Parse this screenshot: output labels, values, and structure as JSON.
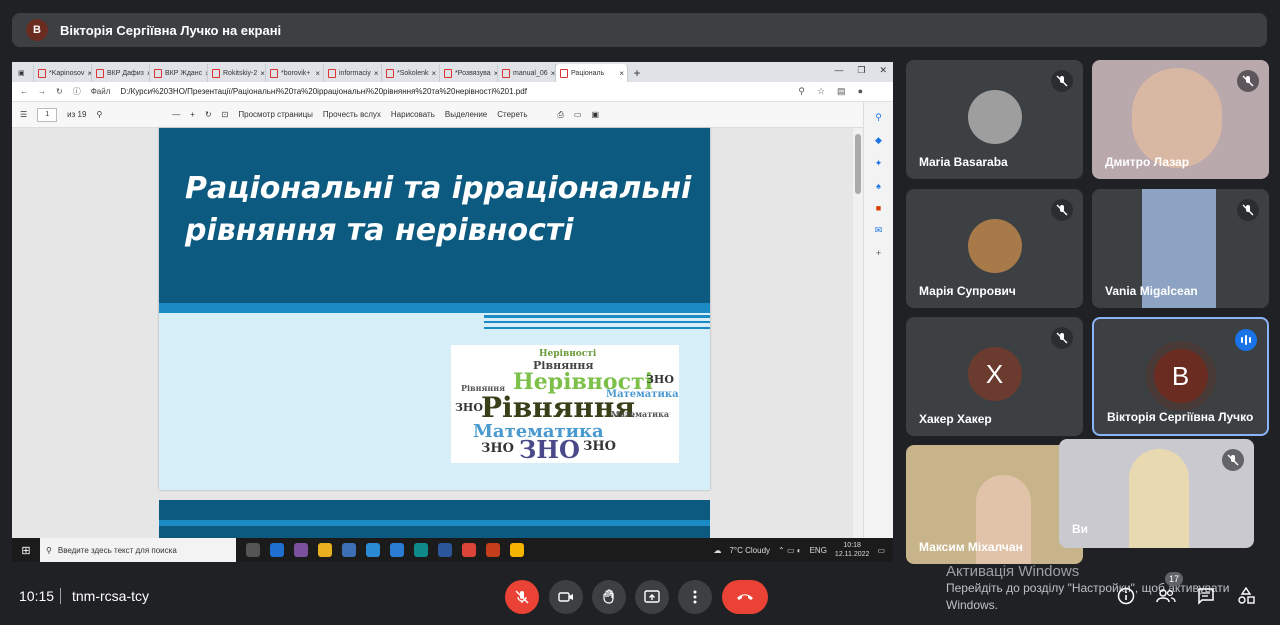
{
  "presenter_bar": {
    "avatar_letter": "В",
    "title": "Вікторія Сергіївна Лучко на екрані"
  },
  "browser": {
    "tabs": [
      "*Kapinosov",
      "ВКР Дафиз",
      "ВКР Жданс",
      "Rokitskiy-2",
      "*borovik+",
      "informaciy",
      "*Sokolenk",
      "*Розвязува",
      "manual_06",
      "Раціональ"
    ],
    "url_prefix": "Файл",
    "url": "D:/Курси%20ЗНО/Презентації/Раціональні%20та%20ірраціональні%20рівняння%20та%20нерівності%201.pdf",
    "page_current": "1",
    "page_total": "из 19",
    "tools": [
      "Просмотр страницы",
      "Прочесть вслух",
      "Нарисовать",
      "Выделение",
      "Стереть"
    ]
  },
  "slide": {
    "title": "Раціональні та ірраціональні рівняння та нерівності",
    "cloud_words": [
      "Нерівності",
      "Рівняння",
      "Нерівності",
      "Рівняння",
      "Математика",
      "ЗНО",
      "ЗНО",
      "ЗНО",
      "Математика",
      "ЗНО",
      "ЗНО",
      "Рівняння",
      "Математика"
    ]
  },
  "taskbar": {
    "search_placeholder": "Введите здесь текст для поиска",
    "weather": "7°C Cloudy",
    "lang": "ENG",
    "clock_time": "10:18",
    "clock_date": "12.11.2022"
  },
  "participants": [
    {
      "name": "Maria Basaraba",
      "avatar_letter": ""
    },
    {
      "name": "Дмитро Лазар",
      "avatar_letter": ""
    },
    {
      "name": "Марія Супрович",
      "avatar_letter": ""
    },
    {
      "name": "Vania Migalcean",
      "avatar_letter": ""
    },
    {
      "name": "Хакер Хакер",
      "avatar_letter": "Х"
    },
    {
      "name": "Вікторія Сергіївна Лучко",
      "avatar_letter": "В"
    },
    {
      "name": "Максим Міхалчан",
      "avatar_letter": ""
    },
    {
      "name": "Ви",
      "avatar_letter": ""
    }
  ],
  "activation": {
    "title": "Активація Windows",
    "text": "Перейдіть до розділу \"Настройки\", щоб активувати Windows."
  },
  "meeting": {
    "time": "10:15",
    "code": "tnm-rcsa-tcy",
    "participant_count": "17"
  },
  "colors": {
    "accent_red": "#ea4335",
    "tile_bg": "#3c4043",
    "speaking_blue": "#1a73e8"
  }
}
